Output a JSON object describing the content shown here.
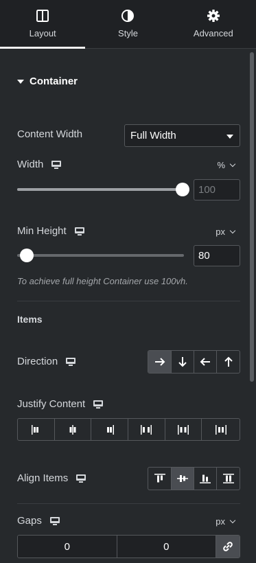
{
  "tabs": [
    {
      "label": "Layout",
      "icon": "layout-columns-icon",
      "active": true
    },
    {
      "label": "Style",
      "icon": "half-circle-icon",
      "active": false
    },
    {
      "label": "Advanced",
      "icon": "gear-icon",
      "active": false
    }
  ],
  "section": {
    "title": "Container",
    "expanded": true
  },
  "content_width": {
    "label": "Content Width",
    "value": "Full Width"
  },
  "width": {
    "label": "Width",
    "unit": "%",
    "value_placeholder": "100",
    "slider_value": 100,
    "slider_max": 100
  },
  "min_height": {
    "label": "Min Height",
    "unit": "px",
    "value": "80",
    "slider_value": 0,
    "hint": "To achieve full height Container use 100vh."
  },
  "items": {
    "heading": "Items",
    "direction": {
      "label": "Direction",
      "options": [
        "arrow-right-icon",
        "arrow-down-icon",
        "arrow-left-icon",
        "arrow-up-icon"
      ],
      "active_index": 0
    },
    "justify_content": {
      "label": "Justify Content",
      "options": [
        "justify-start-icon",
        "justify-center-icon",
        "justify-end-icon",
        "justify-space-between-icon",
        "justify-space-around-icon",
        "justify-space-evenly-icon"
      ]
    },
    "align_items": {
      "label": "Align Items",
      "options": [
        "align-start-icon",
        "align-center-icon",
        "align-end-icon",
        "align-stretch-icon"
      ],
      "active_index": 1
    },
    "gaps": {
      "label": "Gaps",
      "unit": "px",
      "column": "0",
      "row": "0",
      "linked": true
    }
  },
  "colors": {
    "panel_bg": "#26292c",
    "tabs_bg": "#1f2124",
    "active_button": "#4a4d52"
  }
}
